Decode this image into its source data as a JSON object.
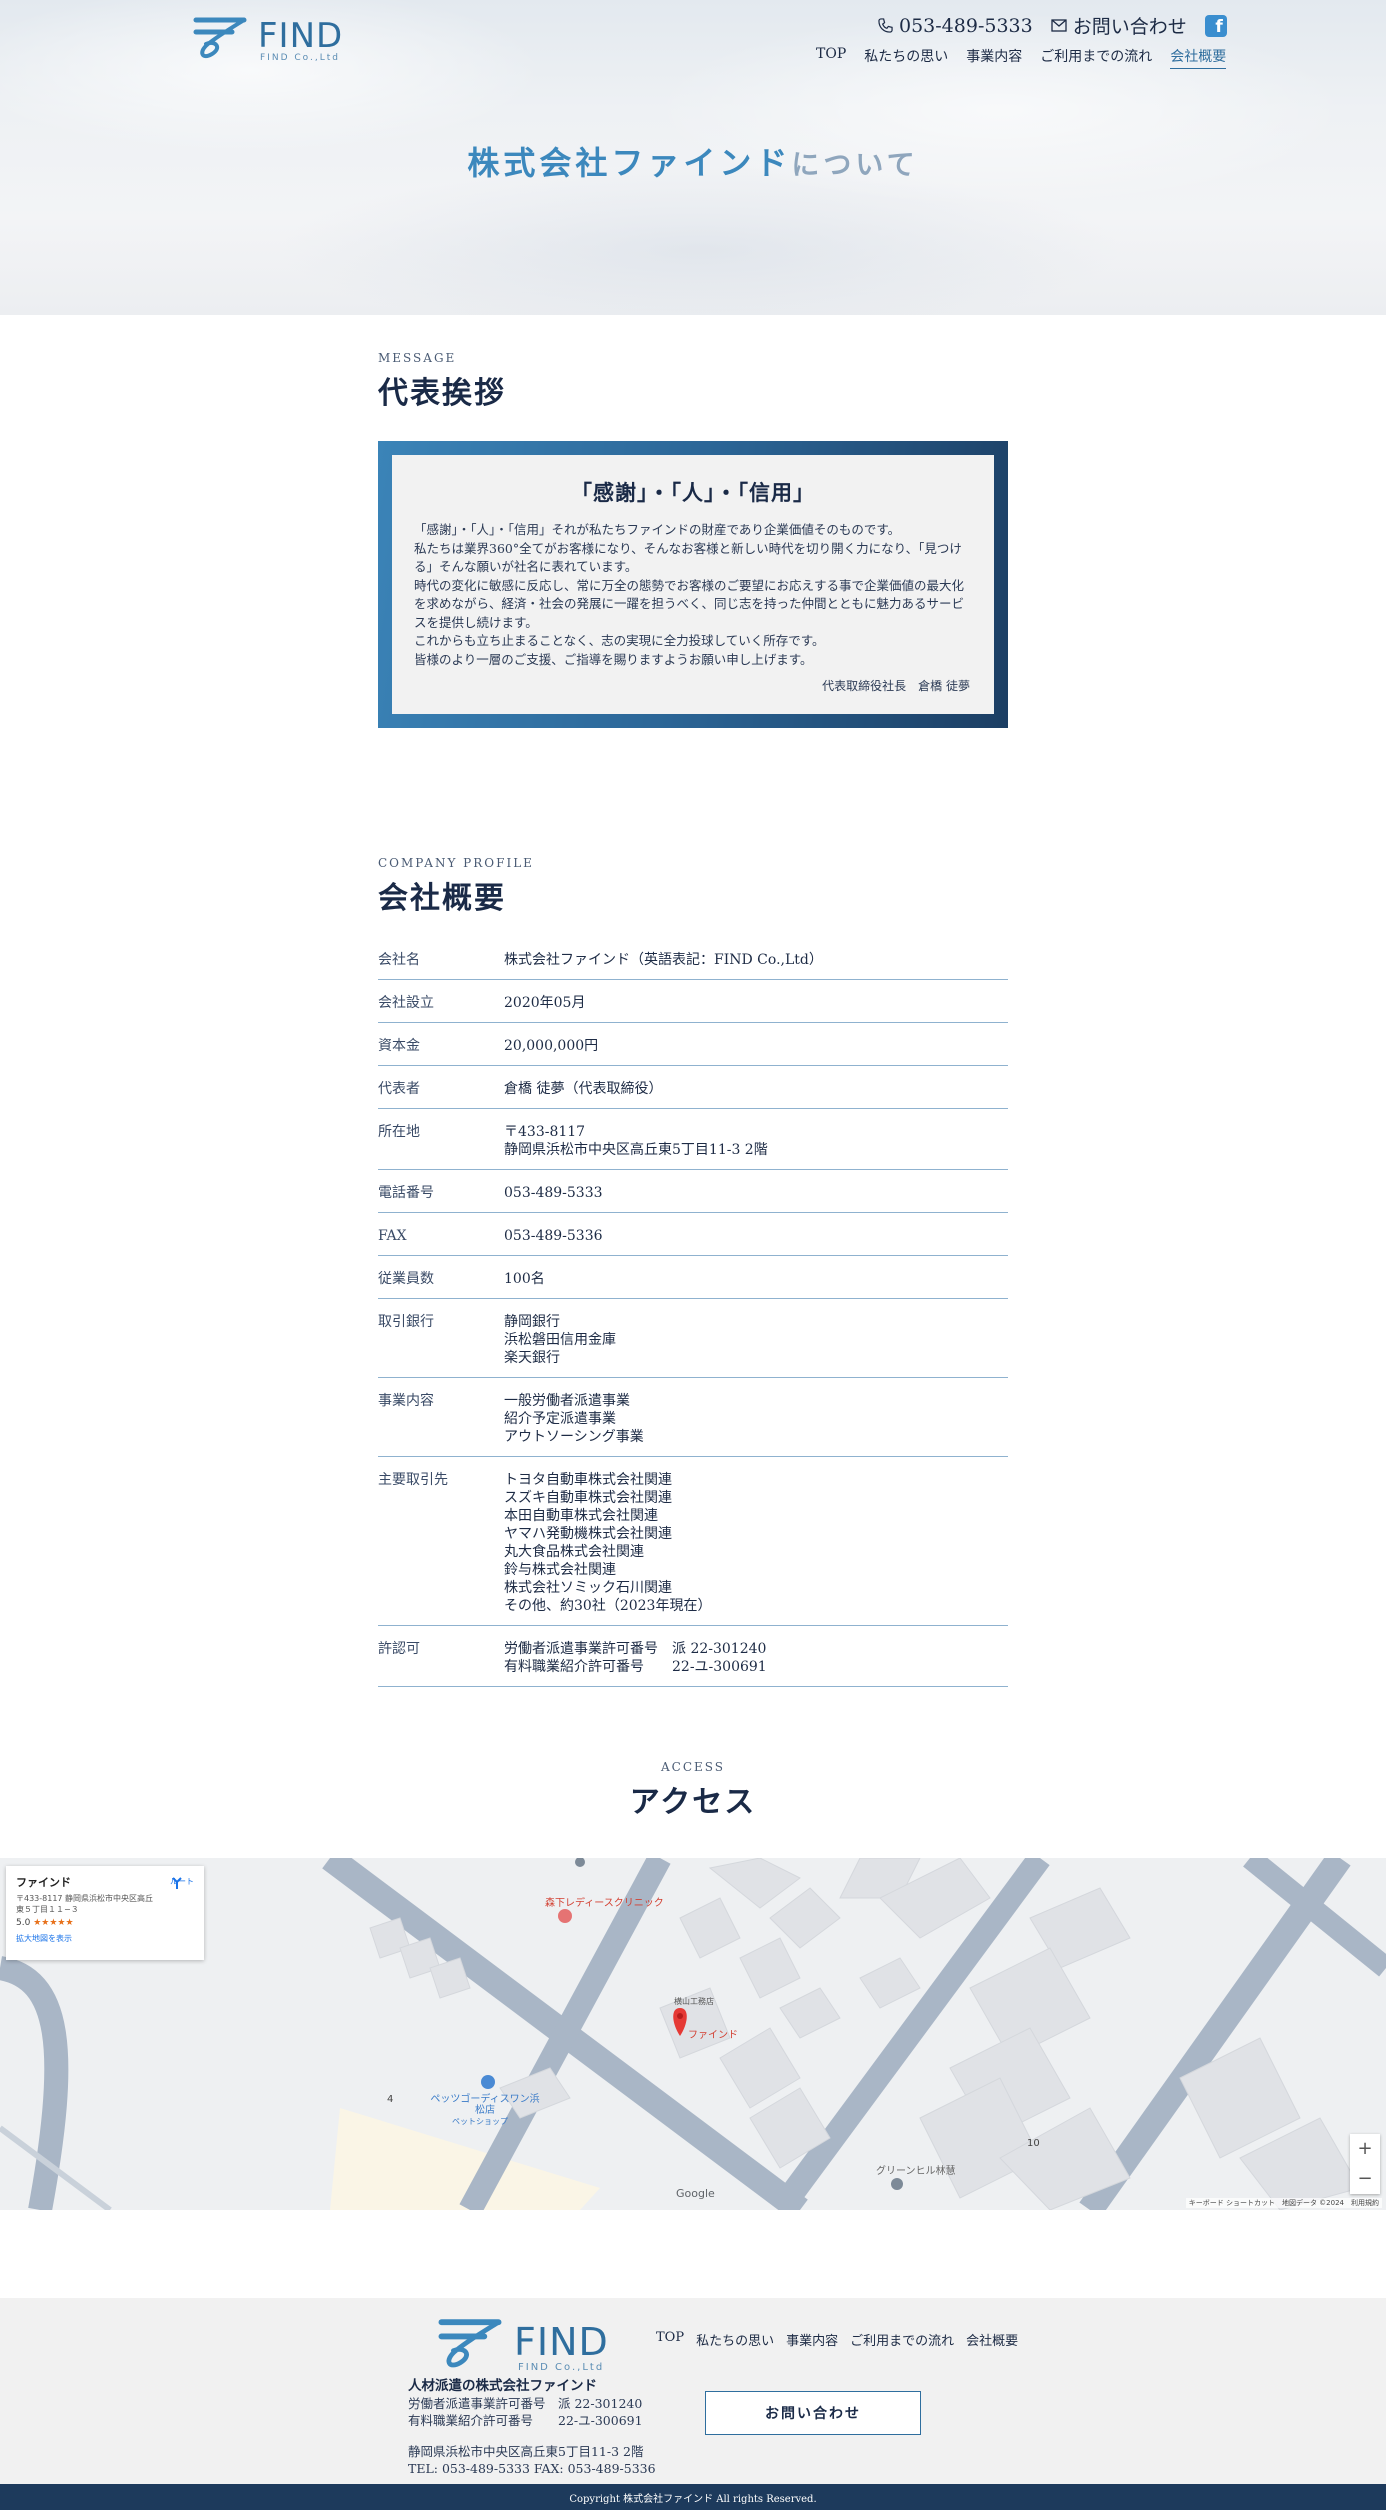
{
  "header": {
    "logo_word": "FIND",
    "logo_sub": "FIND Co.,Ltd",
    "phone": "053-489-5333",
    "contact_label": "お問い合わせ",
    "fb_glyph": "f",
    "nav": [
      "TOP",
      "私たちの思い",
      "事業内容",
      "ご利用までの流れ",
      "会社概要"
    ],
    "active_nav": "会社概要"
  },
  "hero": {
    "title_main": "株式会社ファインド",
    "title_sub": "について"
  },
  "message": {
    "label": "MESSAGE",
    "heading": "代表挨拶",
    "title": "「感謝」・「人」・「信用」",
    "body": [
      "「感謝」・「人」・「信用」それが私たちファインドの財産であり企業価値そのものです。",
      "私たちは業界360°全てがお客様になり、そんなお客様と新しい時代を切り開く力になり、「見つける」そんな願いが社名に表れています。",
      "時代の変化に敏感に反応し、常に万全の態勢でお客様のご要望にお応えする事で企業価値の最大化を求めながら、経済・社会の発展に一躍を担うべく、同じ志を持った仲間とともに魅力あるサービスを提供し続けます。",
      "これからも立ち止まることなく、志の実現に全力投球していく所存です。",
      "皆様のより一層のご支援、ご指導を賜りますようお願い申し上げます。"
    ],
    "sign": "代表取締役社長　倉橋 徒夢"
  },
  "profile": {
    "label": "COMPANY PROFILE",
    "heading": "会社概要",
    "rows": [
      {
        "k": "会社名",
        "v": "株式会社ファインド（英語表記：FIND Co.,Ltd）"
      },
      {
        "k": "会社設立",
        "v": "2020年05月"
      },
      {
        "k": "資本金",
        "v": "20,000,000円"
      },
      {
        "k": "代表者",
        "v": "倉橋 徒夢（代表取締役）"
      },
      {
        "k": "所在地",
        "v": "〒433-8117\n静岡県浜松市中央区高丘東5丁目11-3 2階"
      },
      {
        "k": "電話番号",
        "v": "053-489-5333"
      },
      {
        "k": "FAX",
        "v": "053-489-5336"
      },
      {
        "k": "従業員数",
        "v": "100名"
      },
      {
        "k": "取引銀行",
        "v": "静岡銀行\n浜松磐田信用金庫\n楽天銀行"
      },
      {
        "k": "事業内容",
        "v": "一般労働者派遣事業\n紹介予定派遣事業\nアウトソーシング事業"
      },
      {
        "k": "主要取引先",
        "v": "トヨタ自動車株式会社関連\nスズキ自動車株式会社関連\n本田自動車株式会社関連\nヤマハ発動機株式会社関連\n丸大食品株式会社関連\n鈴与株式会社関連\n株式会社ソミック石川関連\nその他、約30社（2023年現在）"
      },
      {
        "k": "許認可",
        "v": "労働者派遣事業許可番号　派 22-301240\n有料職業紹介許可番号　　22-ユ-300691"
      }
    ]
  },
  "access": {
    "label": "ACCESS",
    "heading": "アクセス",
    "map": {
      "card_title": "ファインド",
      "card_address": "〒433-8117 静岡県浜松市中央区高丘東５丁目１１−３",
      "rating": "5.0",
      "stars": "★★★★★",
      "card_link": "拡大地図を表示",
      "route": "ルート",
      "pin_label": "ファインド",
      "clinic": "森下レディースクリニック",
      "building": "横山工務店",
      "pet": "ペッツゴーディスワン浜松店",
      "pet_sub": "ペットショップ",
      "green": "グリーンヒル林慧",
      "num4": "4",
      "num10": "10",
      "google": "Google",
      "attrib": "キーボード ショートカット　地図データ ©2024　利用規約",
      "zoom_in": "+",
      "zoom_out": "−"
    }
  },
  "footer": {
    "logo_word": "FIND",
    "logo_sub": "FIND Co.,Ltd",
    "nav": [
      "TOP",
      "私たちの思い",
      "事業内容",
      "ご利用までの流れ",
      "会社概要"
    ],
    "company": "人材派遣の株式会社ファインド",
    "license1": "労働者派遣事業許可番号　派 22-301240",
    "license2": "有料職業紹介許可番号　　22-ユ-300691",
    "address": "静岡県浜松市中央区高丘東5丁目11-3 2階",
    "tel_fax": "TEL: 053-489-5333 FAX: 053-489-5336",
    "contact_button": "お問い合わせ",
    "copyright": "Copyright 株式会社ファインド All rights Reserved."
  },
  "colors": {
    "brand": "#2f6e9e",
    "accent": "#3c88bd",
    "navy": "#1d3a5c"
  }
}
